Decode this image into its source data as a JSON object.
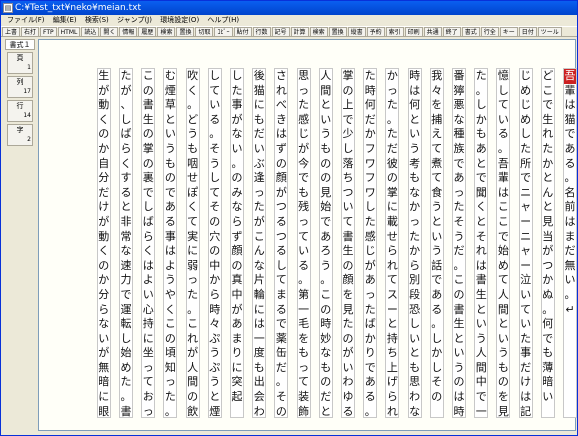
{
  "window": {
    "title": "C:¥Test_txt¥neko¥meian.txt"
  },
  "menu": [
    "ファイル(F)",
    "編集(E)",
    "検索(S)",
    "ジャンプ(J)",
    "環境設定(O)",
    "ヘルプ(H)"
  ],
  "toolbar": [
    "上書",
    "右打",
    "FTP",
    "HTML",
    "読込",
    "開く",
    "情報",
    "履歴",
    "検索",
    "置換",
    "切取",
    "ｺﾋﾟｰ",
    "貼付",
    "行数",
    "記号",
    "計算",
    "検索",
    "置換",
    "縦書",
    "予約",
    "索引",
    "印刷",
    "共通",
    "終了",
    "書式",
    "行全",
    "キー",
    "日付",
    "ツール"
  ],
  "side": {
    "header": "書式１",
    "page_label": "頁",
    "page_value": "1",
    "col_label": "列",
    "col_value": "17",
    "row_label": "行",
    "row_value": "14",
    "char_label": "字",
    "char_value": "2"
  },
  "columns": [
    "吾輩は猫である。名前はまだ無い。↵",
    "どこで生れたかとんと見当がつかぬ。何でも薄暗い",
    "じめじめした所でニャーニャー泣いていた事だけは記",
    "憶している。吾輩はここで始めて人間というものを見",
    "た。しかもあとで聞くとそれは書生という人間中で一",
    "番獰悪な種族であったそうだ。この書生というのは時",
    "我々を捕えて煮て食うという話である。しかしその",
    "時は何という考もなかったから別段恐しいとも思わな",
    "かった。ただ彼の掌に載せられてスーと持ち上げられ",
    "た時何だかフワフワした感じがあったばかりである。",
    "掌の上で少し落ちついて書生の顔を見たのがいわゆる",
    "人間というものの見始であろう。この時妙なものだと",
    "思った感じが今でも残っている。第一毛をもって装飾",
    "されべきはずの顔がつるつるしてまるで薬缶だ。その",
    "後猫にもだいぶ逢ったがこんな片輪には一度も出会わ",
    "した事がない。のみならず顔の真中があまりに突起",
    "している。そうしてその穴の中から時々ぷうぷうと煙を",
    "吹く。どうも咽せぽくて実に弱った。これが人間の飲",
    "む煙草というものである事はようやくこの頃知った。↵",
    "この書生の掌の裏でしばらくはよい心持に坐っておっ",
    "たが、しばらくすると非常な速力で運転し始めた。書",
    "生が動くのか自分だけが動くのか分らないが無暗に眼"
  ]
}
